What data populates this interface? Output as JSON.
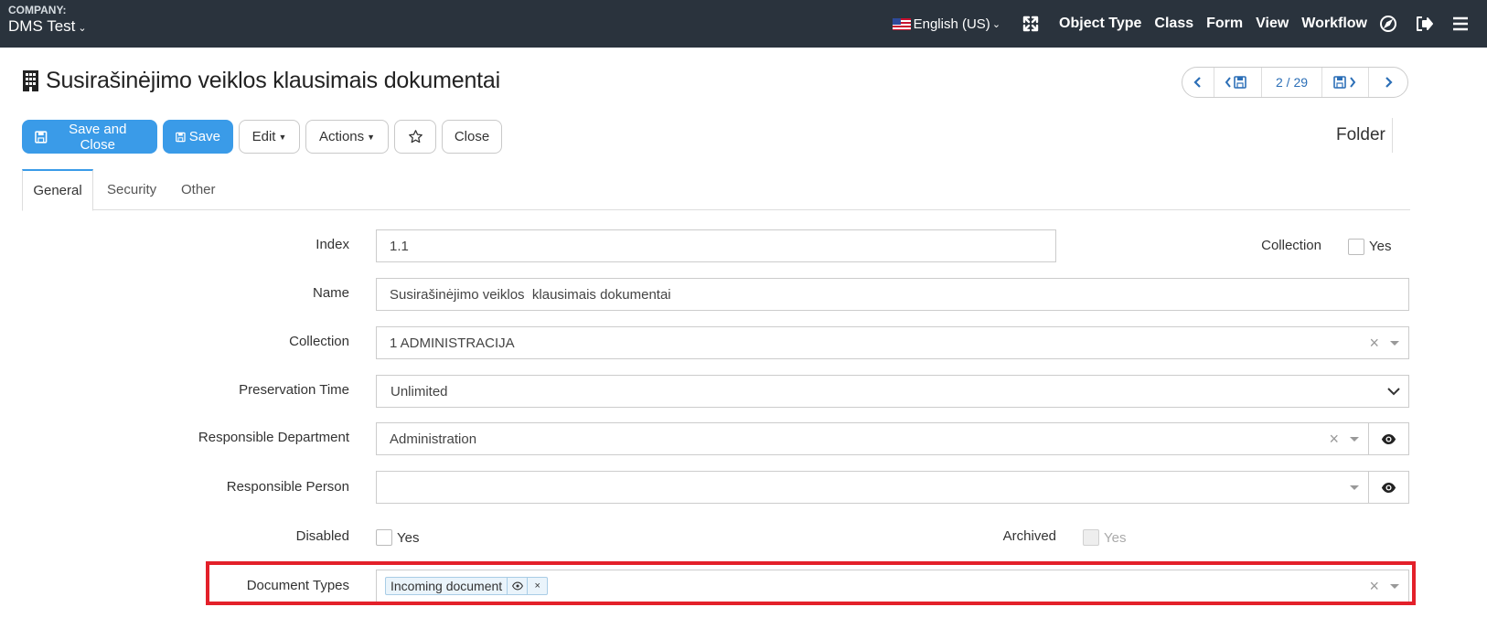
{
  "topbar": {
    "company_label": "COMPANY:",
    "company_name": "DMS Test",
    "language": "English (US)",
    "nav": [
      "Object Type",
      "Class",
      "Form",
      "View",
      "Workflow"
    ]
  },
  "header": {
    "title": "Susirašinėjimo veiklos klausimais dokumentai",
    "pager_position": "2 / 29"
  },
  "toolbar": {
    "save_close": "Save and Close",
    "save": "Save",
    "edit": "Edit",
    "actions": "Actions",
    "close": "Close",
    "folder": "Folder"
  },
  "tabs": [
    "General",
    "Security",
    "Other"
  ],
  "form": {
    "index": {
      "label": "Index",
      "value": "1.1"
    },
    "collection_flag": {
      "label": "Collection",
      "option": "Yes",
      "checked": false
    },
    "name": {
      "label": "Name",
      "value": "Susirašinėjimo veiklos  klausimais dokumentai"
    },
    "collection": {
      "label": "Collection",
      "value": "1 ADMINISTRACIJA"
    },
    "preservation_time": {
      "label": "Preservation Time",
      "value": "Unlimited"
    },
    "responsible_department": {
      "label": "Responsible Department",
      "value": "Administration"
    },
    "responsible_person": {
      "label": "Responsible Person",
      "value": ""
    },
    "disabled": {
      "label": "Disabled",
      "option": "Yes",
      "checked": false
    },
    "archived": {
      "label": "Archived",
      "option": "Yes",
      "checked": false
    },
    "document_types": {
      "label": "Document Types",
      "tags": [
        "Incoming document"
      ]
    }
  },
  "colors": {
    "topbar_bg": "#2a333d",
    "primary": "#3a9be8",
    "link": "#2c6fb7",
    "highlight": "#e3202a"
  }
}
